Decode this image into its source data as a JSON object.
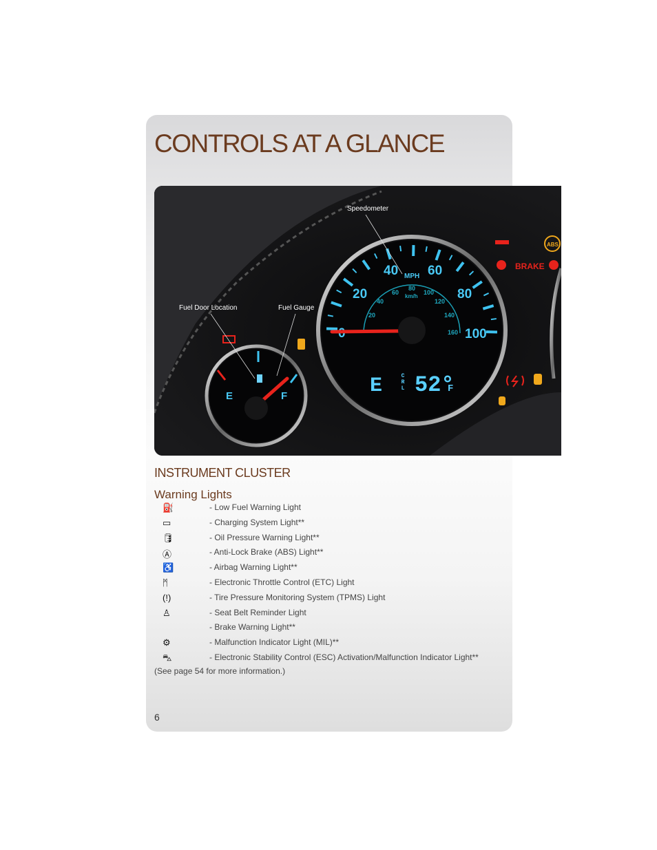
{
  "page": {
    "title": "CONTROLS AT A GLANCE",
    "section": "INSTRUMENT CLUSTER",
    "subsection": "Warning Lights",
    "note": "(See page 54 for more information.)",
    "page_number": "6"
  },
  "photo": {
    "callouts": {
      "speedometer": "Speedometer",
      "fuel_door": "Fuel Door Location",
      "fuel_gauge": "Fuel Gauge"
    },
    "mph_labels": [
      "0",
      "20",
      "40",
      "60",
      "80",
      "100"
    ],
    "mph_unit": "MPH",
    "kmh_labels": [
      "20",
      "40",
      "60",
      "80",
      "100",
      "120",
      "140",
      "160"
    ],
    "kmh_unit": "km/h",
    "fuel_e": "E",
    "fuel_f": "F",
    "display": {
      "compass": "E",
      "mode": "CRL",
      "temp": "52°",
      "unit": "F"
    },
    "brake_text": "BRAKE",
    "abs_text": "ABS"
  },
  "warning_lights": [
    {
      "icon": "fuel-pump-icon",
      "label": "- Low Fuel Warning Light"
    },
    {
      "icon": "battery-icon",
      "label": "- Charging System Light**"
    },
    {
      "icon": "oil-can-icon",
      "label": "- Oil Pressure Warning Light**"
    },
    {
      "icon": "abs-icon",
      "label": "- Anti-Lock Brake (ABS) Light**"
    },
    {
      "icon": "airbag-icon",
      "label": "- Airbag Warning Light**"
    },
    {
      "icon": "throttle-icon",
      "label": "- Electronic Throttle Control (ETC) Light"
    },
    {
      "icon": "tire-pressure-icon",
      "label": "- Tire Pressure Monitoring System (TPMS) Light"
    },
    {
      "icon": "seatbelt-icon",
      "label": "- Seat Belt Reminder Light"
    },
    {
      "icon": "",
      "label": "- Brake Warning Light**"
    },
    {
      "icon": "engine-icon",
      "label": "- Malfunction Indicator Light (MIL)**"
    },
    {
      "icon": "stability-control-icon",
      "label": "- Electronic Stability Control (ESC) Activation/Malfunction Indicator Light**"
    }
  ],
  "colors": {
    "heading": "#6b3b1f",
    "gauge_blue": "#3fc3f0",
    "needle": "#e8231c",
    "warning_red": "#e8231c",
    "warning_amber": "#f0a81c"
  }
}
